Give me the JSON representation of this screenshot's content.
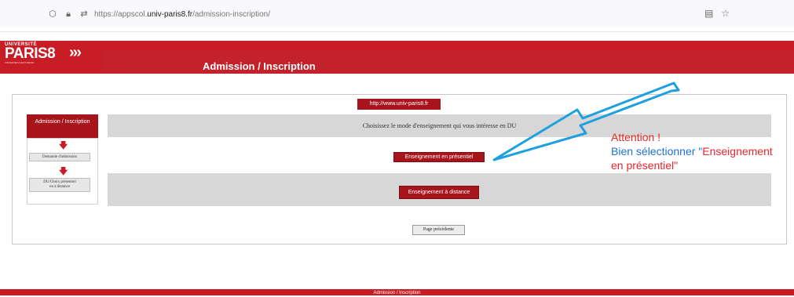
{
  "browser": {
    "url_prefix": "https://appscol.",
    "url_domain": "univ-paris8.fr",
    "url_path": "/admission-inscription/",
    "icons": [
      "shield-icon",
      "lock-icon",
      "permissions-icon",
      "reader-view-icon",
      "bookmark-star-icon"
    ]
  },
  "header": {
    "logo_top": "UNIVERSITÉ",
    "logo_main": "PARIS8",
    "logo_sub": "VINCENNES-SAINT-DENIS",
    "chevrons": "›››",
    "title": "Admission / Inscription"
  },
  "main": {
    "univ_link": "http://www.univ-paris8.fr",
    "question": "Choisissez le mode d'enseignement qui vous intéresse en DU",
    "btn_presentiel": "Enseignement en présentiel",
    "btn_distance": "Enseignement à distance",
    "prev_button": "Page précédente"
  },
  "sidebar": {
    "header": "Admission / Inscription",
    "step1": "Demande d'admission",
    "step2_line1": "DU/Choix présentiel",
    "step2_line2": "ou à distance"
  },
  "annotation": {
    "line1": "Attention !",
    "line2_blue": "Bien sélectionner \"",
    "line2_red": "Enseignement",
    "line3": "en présentiel\""
  },
  "footer": {
    "text": "Admission / Inscription"
  },
  "colors": {
    "brand_red": "#c91d26",
    "button_red": "#a8141c",
    "annotation_red": "#e8262a",
    "annotation_blue": "#1b74d6",
    "arrow_blue": "#1ea0e0"
  }
}
